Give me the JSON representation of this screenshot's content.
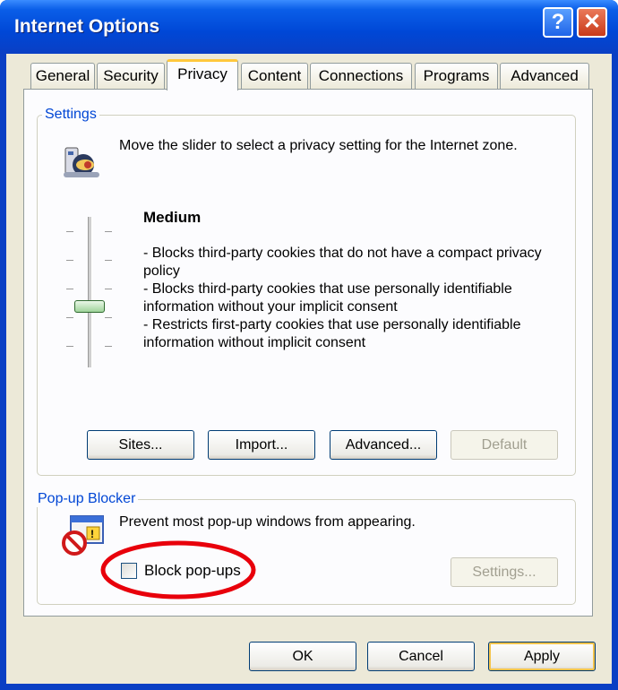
{
  "window": {
    "title": "Internet Options",
    "help_glyph": "?",
    "close_glyph": "✕"
  },
  "tabs": [
    {
      "label": "General",
      "active": false
    },
    {
      "label": "Security",
      "active": false
    },
    {
      "label": "Privacy",
      "active": true
    },
    {
      "label": "Content",
      "active": false
    },
    {
      "label": "Connections",
      "active": false
    },
    {
      "label": "Programs",
      "active": false
    },
    {
      "label": "Advanced",
      "active": false
    }
  ],
  "settings": {
    "legend": "Settings",
    "description": "Move the slider to select a privacy setting for the Internet zone.",
    "level_title": "Medium",
    "level_lines": [
      "- Blocks third-party cookies that do not have a compact privacy policy",
      "- Blocks third-party cookies that use personally identifiable information without your implicit consent",
      "- Restricts first-party cookies that use personally identifiable information without implicit consent"
    ],
    "slider_level": "Medium",
    "buttons": {
      "sites": "Sites...",
      "import": "Import...",
      "advanced": "Advanced...",
      "default": "Default"
    }
  },
  "popup_blocker": {
    "legend": "Pop-up Blocker",
    "description": "Prevent most pop-up windows from appearing.",
    "checkbox_label": "Block pop-ups",
    "checked": false,
    "settings_button": "Settings..."
  },
  "footer": {
    "ok": "OK",
    "cancel": "Cancel",
    "apply": "Apply"
  },
  "annotation": {
    "color": "#e8000b",
    "shape": "ellipse"
  }
}
